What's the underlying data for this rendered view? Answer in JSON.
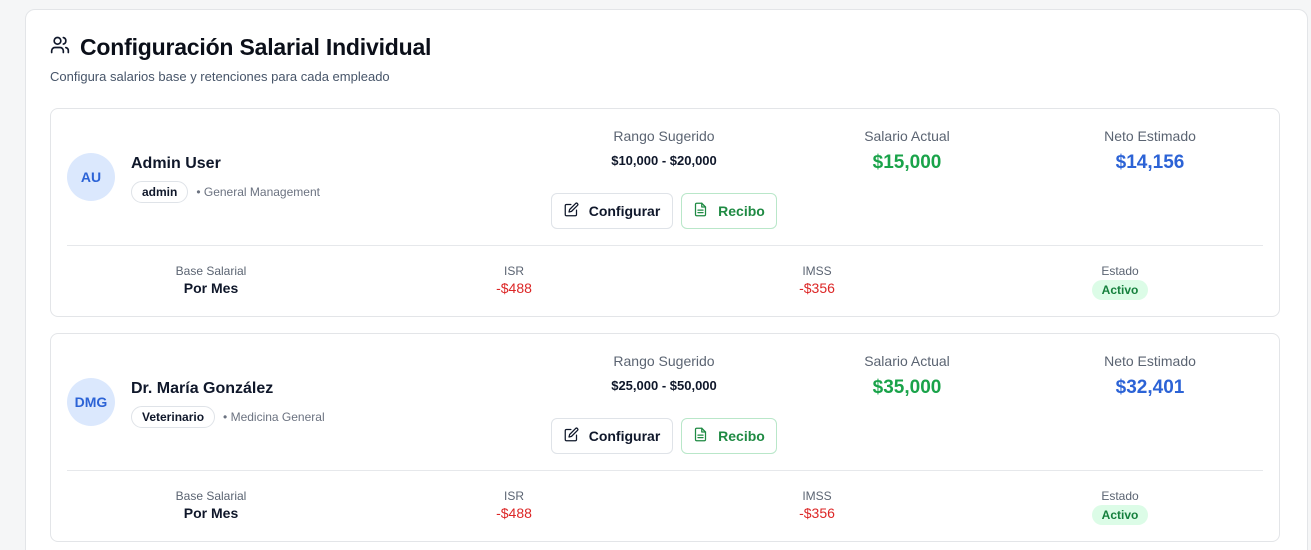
{
  "header": {
    "title": "Configuración Salarial Individual",
    "subtitle": "Configura salarios base y retenciones para cada empleado",
    "icon": "users-icon"
  },
  "colors": {
    "green": "#1aa34a",
    "blue": "#2c63d6",
    "red": "#dc2626",
    "badge_green_bg": "#dcfce7"
  },
  "labels": {
    "range": "Rango Sugerido",
    "current_salary": "Salario Actual",
    "net_estimate": "Neto Estimado",
    "configure": "Configurar",
    "receipt": "Recibo",
    "base_salary": "Base Salarial",
    "isr": "ISR",
    "imss": "IMSS",
    "status": "Estado"
  },
  "employees": [
    {
      "initials": "AU",
      "name": "Admin User",
      "role": "admin",
      "department": "• General Management",
      "range": "$10,000 - $20,000",
      "current_salary": "$15,000",
      "net_estimate": "$14,156",
      "base": "Por Mes",
      "isr": "-$488",
      "imss": "-$356",
      "status": "Activo"
    },
    {
      "initials": "DMG",
      "name": "Dr. María González",
      "role": "Veterinario",
      "department": "• Medicina General",
      "range": "$25,000 - $50,000",
      "current_salary": "$35,000",
      "net_estimate": "$32,401",
      "base": "Por Mes",
      "isr": "-$488",
      "imss": "-$356",
      "status": "Activo"
    }
  ]
}
